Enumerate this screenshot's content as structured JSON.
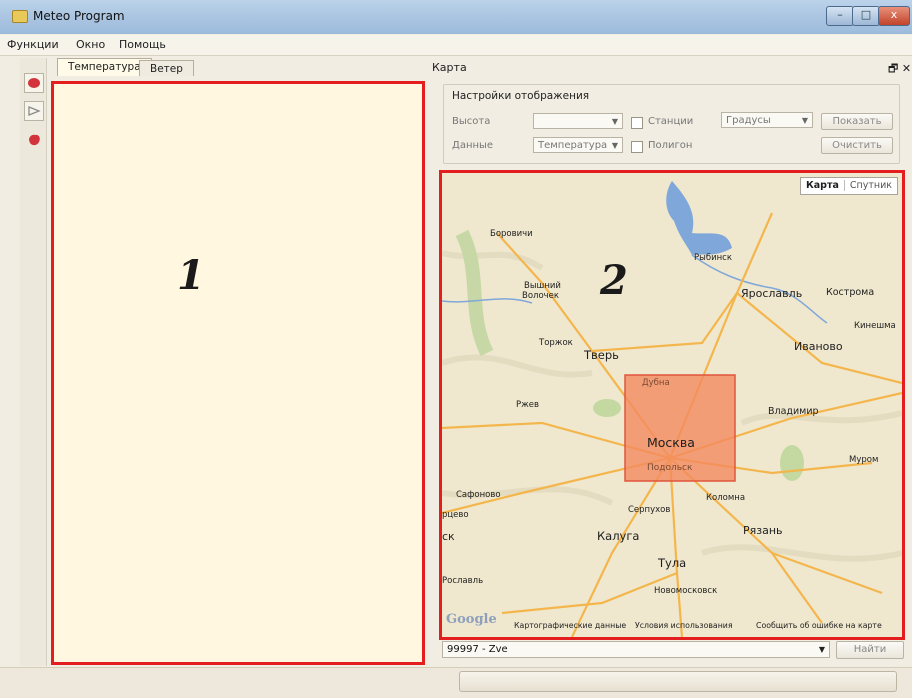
{
  "window": {
    "title": "Meteo Program",
    "min": "–",
    "max": "□",
    "close": "x"
  },
  "menu": [
    "Функции",
    "Окно",
    "Помощь"
  ],
  "left_panel": {
    "tabs": [
      "Температура",
      "Ветер"
    ],
    "number": "1"
  },
  "map_dock": {
    "title": "Карта",
    "controls": "🗗 ✕",
    "settings": {
      "title": "Настройки отображения",
      "height_label": "Высота",
      "height_value": "",
      "data_label": "Данные",
      "data_value": "Температура",
      "stations_label": "Станции",
      "polygon_label": "Полигон",
      "units_value": "Градусы",
      "show_button": "Показать",
      "clear_button": "Очистить"
    },
    "map": {
      "number": "2",
      "type_map": "Карта",
      "type_satellite": "Спутник",
      "google": "Google",
      "footer_data": "Картографические данные",
      "footer_terms": "Условия использования",
      "footer_report": "Сообщить об ошибке на карте",
      "cities": {
        "borovichi": "Боровичи",
        "rybinsk": "Рыбинск",
        "vyshny": "Вышний",
        "volochek": "Волочек",
        "yaroslavl": "Ярославль",
        "kostroma": "Кострома",
        "kineshma": "Кинешма",
        "torzhok": "Торжок",
        "tver": "Тверь",
        "ivanovo": "Иваново",
        "dubna": "Дубна",
        "rzhev": "Ржев",
        "vladimir": "Владимир",
        "moskva": "Москва",
        "murom": "Муром",
        "podolsk": "Подольск",
        "safonovo": "Сафоново",
        "kolomna": "Коломна",
        "rtsevo": "рцево",
        "serpukhov": "Серпухов",
        "ryazan": "Рязань",
        "ck": "ск",
        "kaluga": "Калуга",
        "tula": "Тула",
        "roslavl": "Рославль",
        "novomoskovsk": "Новомосковск"
      },
      "colors": {
        "land": "#efe8cf",
        "water": "#7fa7d9",
        "road": "#f4b64c",
        "forest": "#c4d8a2",
        "selection": "#f48a5f"
      }
    },
    "station": "99997 - Zve",
    "find_button": "Найти"
  }
}
